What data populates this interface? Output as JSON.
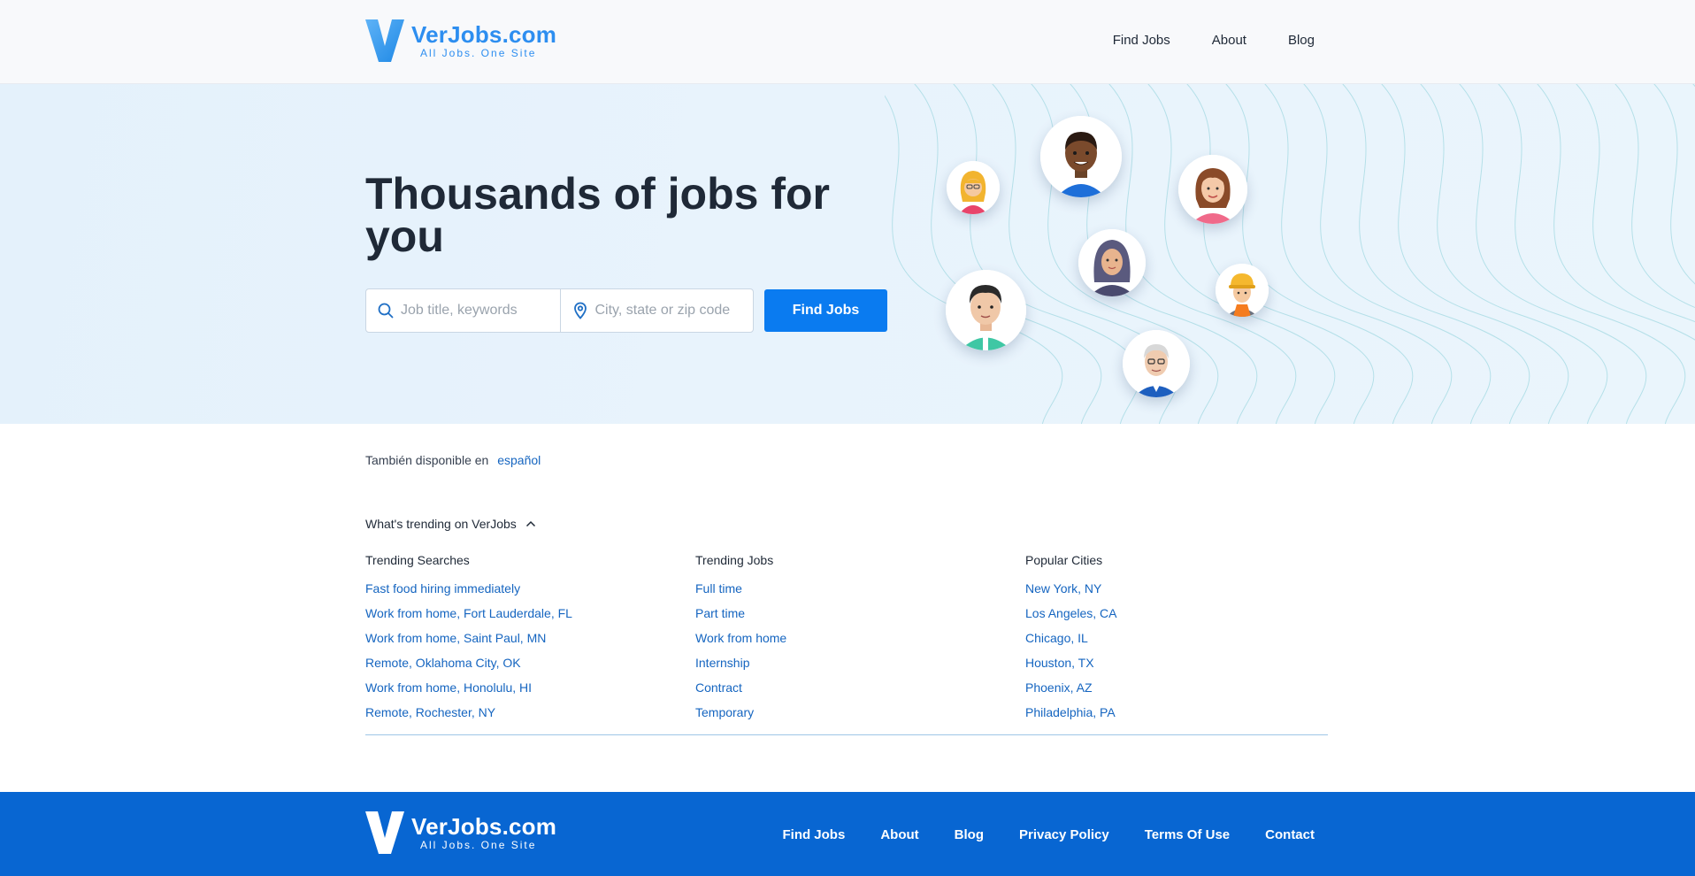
{
  "header": {
    "logo_name": "VerJobs.com",
    "logo_tagline": "All Jobs. One Site",
    "nav": [
      "Find Jobs",
      "About",
      "Blog"
    ]
  },
  "hero": {
    "title": "Thousands of jobs for you",
    "search": {
      "keyword_placeholder": "Job title, keywords",
      "location_placeholder": "City, state or zip code",
      "button_label": "Find Jobs"
    }
  },
  "language": {
    "text": "También disponible en",
    "link": "español"
  },
  "trending": {
    "toggle_label": "What's trending on VerJobs",
    "columns": [
      {
        "title": "Trending Searches",
        "items": [
          "Fast food hiring immediately",
          "Work from home, Fort Lauderdale, FL",
          "Work from home, Saint Paul, MN",
          "Remote, Oklahoma City, OK",
          "Work from home, Honolulu, HI",
          "Remote, Rochester, NY"
        ]
      },
      {
        "title": "Trending Jobs",
        "items": [
          "Full time",
          "Part time",
          "Work from home",
          "Internship",
          "Contract",
          "Temporary"
        ]
      },
      {
        "title": "Popular Cities",
        "items": [
          "New York, NY",
          "Los Angeles, CA",
          "Chicago, IL",
          "Houston, TX",
          "Phoenix, AZ",
          "Philadelphia, PA"
        ]
      }
    ]
  },
  "footer": {
    "logo_name": "VerJobs.com",
    "logo_tagline": "All Jobs. One Site",
    "nav": [
      "Find Jobs",
      "About",
      "Blog",
      "Privacy Policy",
      "Terms Of Use",
      "Contact"
    ]
  },
  "colors": {
    "brand_blue": "#0a7bf0",
    "footer_blue": "#0866d2",
    "link_blue": "#1565c0",
    "hero_bg": "#e6f2fc"
  },
  "icons": [
    "logo-v-icon",
    "search-icon",
    "location-pin-icon",
    "chevron-up-icon"
  ]
}
